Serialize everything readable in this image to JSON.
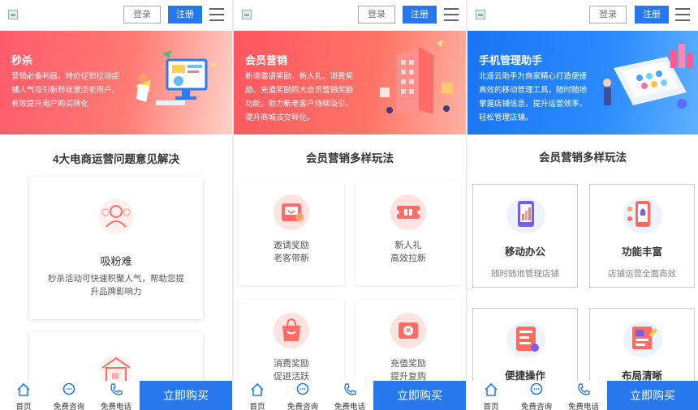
{
  "header": {
    "login_label": "登录",
    "register_label": "注册"
  },
  "panels": [
    {
      "banner": {
        "title": "秒杀",
        "text": "营销必备利器，特价促销拉动店铺人气吸引新粉丝激活老用户，有效提升用户购买转化"
      },
      "section_title": "4大电商运营问题意见解决",
      "cards": [
        {
          "title": "吸粉难",
          "desc": "秒杀活动可快速积聚人气，帮助您提升品牌影响力"
        }
      ]
    },
    {
      "banner": {
        "title": "会员营销",
        "text": "新增邀请奖励、新人礼、消费奖励、充值奖励四大会员营销奖励功能，助力新老客户持续吸引，提升商城成交转化。"
      },
      "section_title": "会员营销多样玩法",
      "cards": [
        {
          "line1": "邀请奖励",
          "line2": "老客带新"
        },
        {
          "line1": "新人礼",
          "line2": "高效拉新"
        },
        {
          "line1": "消费奖励",
          "line2": "促进活跃"
        },
        {
          "line1": "充值奖励",
          "line2": "提升复购"
        }
      ]
    },
    {
      "banner": {
        "title": "手机管理助手",
        "text": "北遥云助手为商家精心打造便捷高效的移动管理工具，随时随地掌握店铺信息，提升运营效率，轻松管理店铺。"
      },
      "section_title": "会员营销多样玩法",
      "cards": [
        {
          "title": "移动办公",
          "desc": "随时随地管理店铺"
        },
        {
          "title": "功能丰富",
          "desc": "店铺运营全面高效"
        },
        {
          "title": "便捷操作",
          "desc": ""
        },
        {
          "title": "布局清晰",
          "desc": ""
        }
      ]
    }
  ],
  "footer": {
    "home_label": "首页",
    "consult_label": "免费咨询",
    "phone_label": "免费电话",
    "buy_label": "立即购买"
  },
  "colors": {
    "accent": "#2778ec",
    "banner_red": "#ff5a6b",
    "banner_blue": "#1a73f5"
  }
}
